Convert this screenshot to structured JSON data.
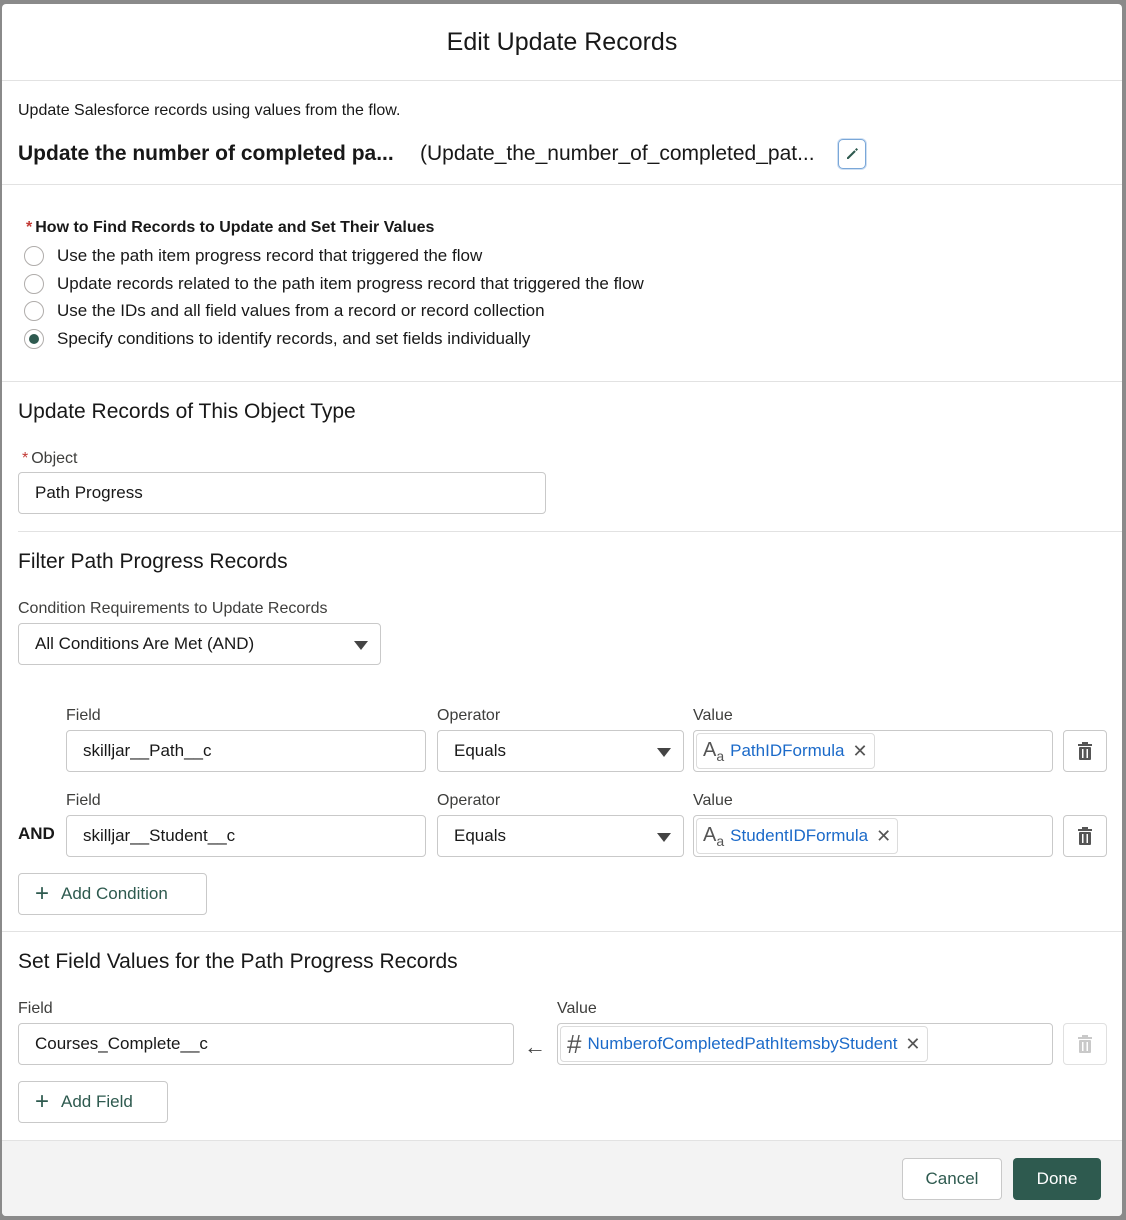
{
  "modal": {
    "title": "Edit Update Records"
  },
  "details": {
    "description": "Update Salesforce records using values from the flow.",
    "label": "Update the number of completed pa...",
    "api_name": "(Update_the_number_of_completed_pat..."
  },
  "find_records": {
    "heading": "How to Find Records to Update and Set Their Values",
    "options": [
      {
        "label": "Use the path item progress record that triggered the flow",
        "checked": false
      },
      {
        "label": "Update records related to the path item progress record that triggered the flow",
        "checked": false
      },
      {
        "label": "Use the IDs and all field values from a record or record collection",
        "checked": false
      },
      {
        "label": "Specify conditions to identify records, and set fields individually",
        "checked": true
      }
    ]
  },
  "object_section": {
    "heading": "Update Records of This Object Type",
    "object_label": "Object",
    "object_value": "Path Progress"
  },
  "filter": {
    "heading": "Filter Path Progress Records",
    "requirement_label": "Condition Requirements to Update Records",
    "requirement_value": "All Conditions Are Met (AND)",
    "logic_word": "AND",
    "conditions": [
      {
        "field_label": "Field",
        "field": "skilljar__Path__c",
        "operator_label": "Operator",
        "operator": "Equals",
        "value_label": "Value",
        "value": "PathIDFormula"
      },
      {
        "field_label": "Field",
        "field": "skilljar__Student__c",
        "operator_label": "Operator",
        "operator": "Equals",
        "value_label": "Value",
        "value": "StudentIDFormula"
      }
    ],
    "add_condition_label": "Add Condition"
  },
  "set_fields": {
    "heading": "Set Field Values for the Path Progress Records",
    "field_label": "Field",
    "field": "Courses_Complete__c",
    "value_label": "Value",
    "value": "NumberofCompletedPathItemsbyStudent",
    "add_field_label": "Add Field"
  },
  "footer": {
    "cancel_label": "Cancel",
    "done_label": "Done"
  },
  "colors": {
    "brand": "#2e5a4f",
    "link": "#1b6ac9",
    "required": "#c23934"
  }
}
